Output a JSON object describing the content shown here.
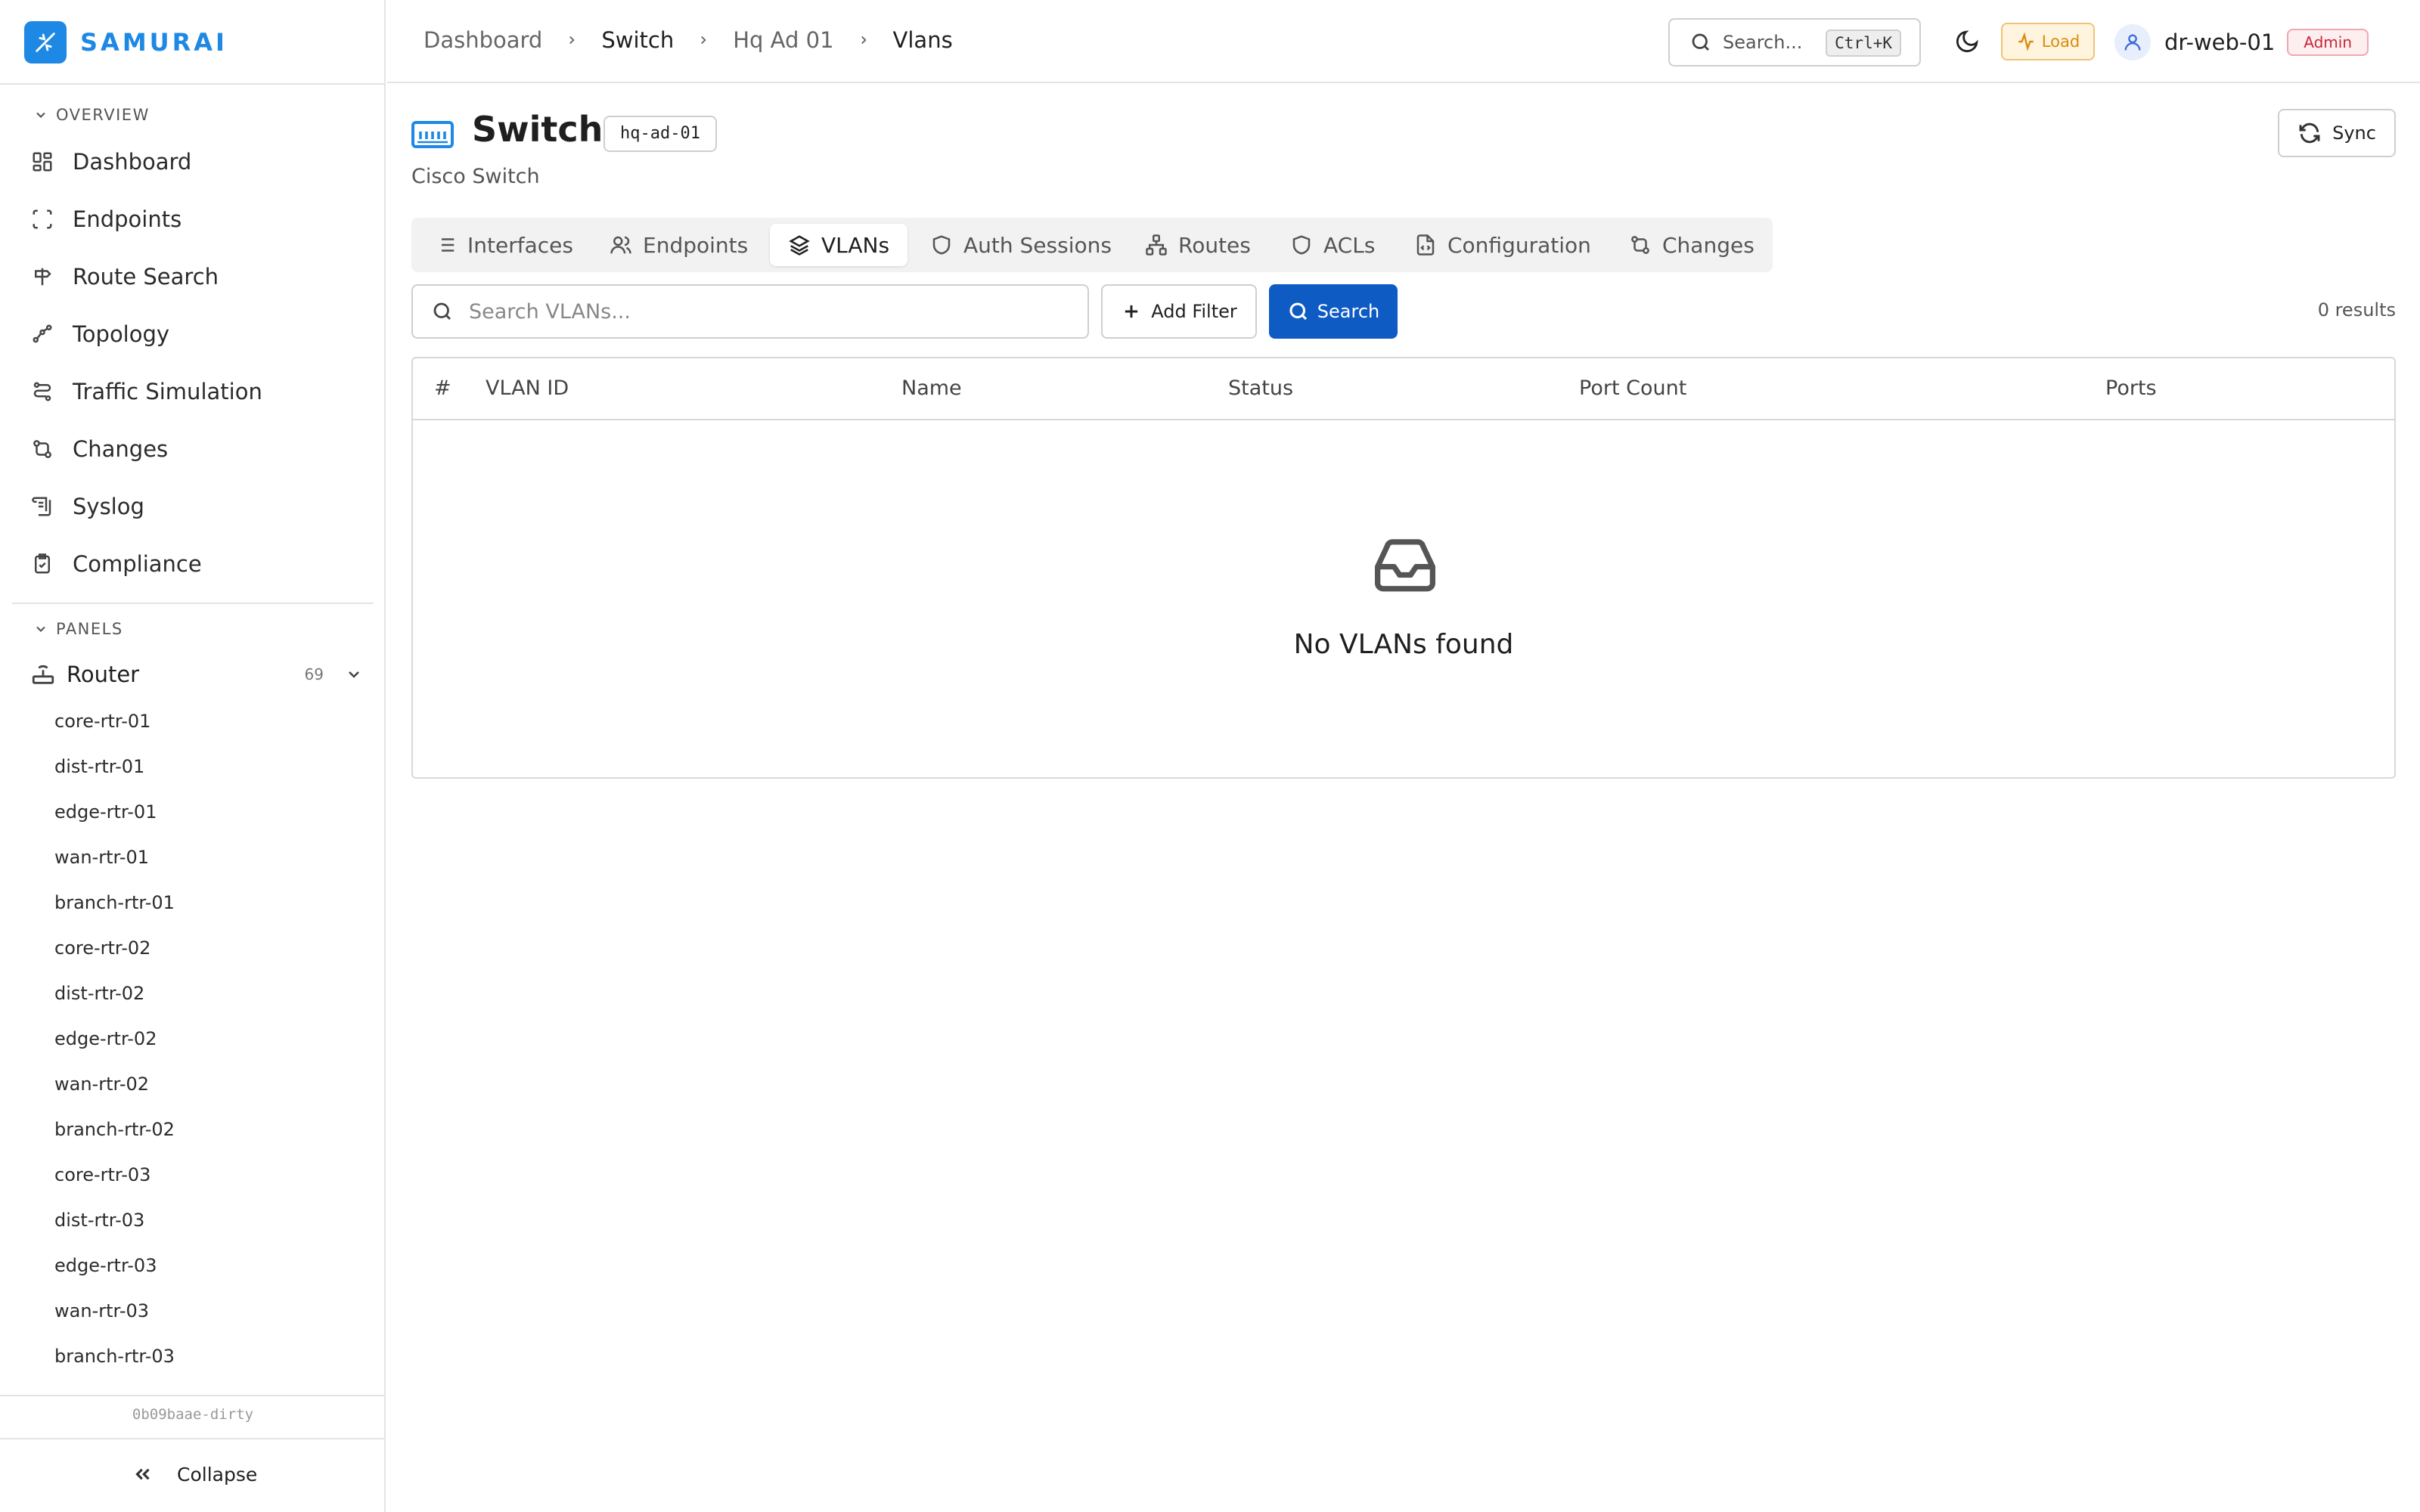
{
  "brand": {
    "name": "SAMURAI"
  },
  "sidebar": {
    "overview_label": "OVERVIEW",
    "nav": [
      {
        "label": "Dashboard",
        "icon": "grid-icon"
      },
      {
        "label": "Endpoints",
        "icon": "scan-icon"
      },
      {
        "label": "Route Search",
        "icon": "signpost-icon"
      },
      {
        "label": "Topology",
        "icon": "topology-icon"
      },
      {
        "label": "Traffic Simulation",
        "icon": "flow-icon"
      },
      {
        "label": "Changes",
        "icon": "git-compare-icon"
      },
      {
        "label": "Syslog",
        "icon": "scroll-icon"
      },
      {
        "label": "Compliance",
        "icon": "clipboard-check-icon"
      }
    ],
    "panels_label": "PANELS",
    "router": {
      "label": "Router",
      "count": "69"
    },
    "routers": [
      "core-rtr-01",
      "dist-rtr-01",
      "edge-rtr-01",
      "wan-rtr-01",
      "branch-rtr-01",
      "core-rtr-02",
      "dist-rtr-02",
      "edge-rtr-02",
      "wan-rtr-02",
      "branch-rtr-02",
      "core-rtr-03",
      "dist-rtr-03",
      "edge-rtr-03",
      "wan-rtr-03",
      "branch-rtr-03"
    ],
    "version": "0b09baae-dirty",
    "collapse_label": "Collapse"
  },
  "topbar": {
    "breadcrumbs": [
      "Dashboard",
      "Switch",
      "Hq Ad 01",
      "Vlans"
    ],
    "search_placeholder": "Search...",
    "search_shortcut": "Ctrl+K",
    "load_label": "Load",
    "username": "dr-web-01",
    "role_badge": "Admin"
  },
  "page": {
    "title": "Switch",
    "device_id": "hq-ad-01",
    "subtitle": "Cisco Switch",
    "sync_label": "Sync"
  },
  "tabs": [
    {
      "label": "Interfaces",
      "icon": "list-icon",
      "active": false
    },
    {
      "label": "Endpoints",
      "icon": "users-icon",
      "active": false
    },
    {
      "label": "VLANs",
      "icon": "layers-icon",
      "active": true
    },
    {
      "label": "Auth Sessions",
      "icon": "shield-icon",
      "active": false
    },
    {
      "label": "Routes",
      "icon": "network-icon",
      "active": false
    },
    {
      "label": "ACLs",
      "icon": "shield-icon",
      "active": false
    },
    {
      "label": "Configuration",
      "icon": "file-code-icon",
      "active": false
    },
    {
      "label": "Changes",
      "icon": "git-compare-icon",
      "active": false
    }
  ],
  "filter_bar": {
    "search_placeholder": "Search VLANs...",
    "add_filter_label": "Add Filter",
    "search_label": "Search",
    "results_text": "0 results"
  },
  "table": {
    "columns": [
      "#",
      "VLAN ID",
      "Name",
      "Status",
      "Port Count",
      "Ports"
    ],
    "rows": [],
    "empty_text": "No VLANs found"
  },
  "colors": {
    "accent": "#1e88e5",
    "primary_button": "#0e5bc4",
    "load_warning": "#d98b10",
    "admin_badge": "#c62837"
  }
}
